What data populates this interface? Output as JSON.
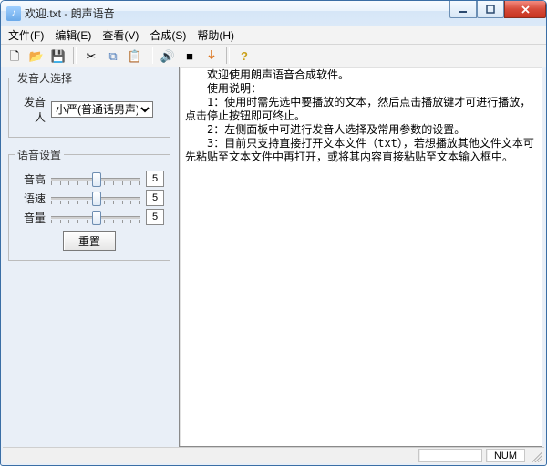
{
  "window": {
    "title": "欢迎.txt - 朗声语音"
  },
  "menus": {
    "file": "文件(F)",
    "edit": "编辑(E)",
    "view": "查看(V)",
    "synth": "合成(S)",
    "help": "帮助(H)"
  },
  "sidebar": {
    "voice": {
      "legend": "发音人选择",
      "label": "发音人",
      "selected": "小严(普通话男声)"
    },
    "settings": {
      "legend": "语音设置",
      "pitch": {
        "label": "音高",
        "value": "5"
      },
      "speed": {
        "label": "语速",
        "value": "5"
      },
      "volume": {
        "label": "音量",
        "value": "5"
      },
      "reset": "重置"
    }
  },
  "textarea": "　　欢迎使用朗声语音合成软件。\n　　使用说明：\n　　1：使用时需先选中要播放的文本，然后点击播放键才可进行播放，点击停止按钮即可终止。\n　　2：左侧面板中可进行发音人选择及常用参数的设置。\n　　3：目前只支持直接打开文本文件（txt），若想播放其他文件文本可先粘贴至文本文件中再打开，或将其内容直接粘贴至文本输入框中。",
  "status": {
    "num": "NUM"
  }
}
